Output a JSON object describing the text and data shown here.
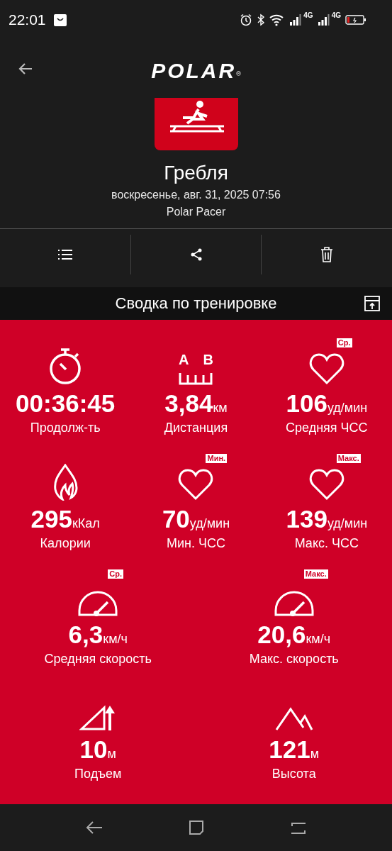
{
  "status_bar": {
    "time": "22:01",
    "network_labels": [
      "4G",
      "4G"
    ]
  },
  "header": {
    "logo": "POLAR",
    "logo_mark": "®"
  },
  "workout": {
    "title": "Гребля",
    "date": "воскресенье, авг. 31, 2025 07:56",
    "device": "Polar Pacer"
  },
  "section": {
    "title": "Сводка по тренировке"
  },
  "stat_rows": [
    [
      {
        "kind": "duration",
        "value": "00:36:45",
        "label": "Продолж-ть"
      },
      {
        "kind": "distance",
        "icon_labels": [
          "A",
          "B"
        ],
        "value": "3,84",
        "unit": "км",
        "label": "Дистанция"
      },
      {
        "kind": "heart",
        "badge": "Ср.",
        "value": "106",
        "unit": "уд/мин",
        "label": "Средняя ЧСС"
      }
    ],
    [
      {
        "kind": "calories",
        "value": "295",
        "unit": "кКал",
        "label": "Калории"
      },
      {
        "kind": "heart",
        "badge": "Мин.",
        "value": "70",
        "unit": "уд/мин",
        "label": "Мин. ЧСС"
      },
      {
        "kind": "heart",
        "badge": "Макс.",
        "value": "139",
        "unit": "уд/мин",
        "label": "Макс. ЧСС"
      }
    ],
    [
      {
        "kind": "speed",
        "badge": "Ср.",
        "value": "6,3",
        "unit": "км/ч",
        "label": "Средняя скорость"
      },
      {
        "kind": "speed",
        "badge": "Макс.",
        "value": "20,6",
        "unit": "км/ч",
        "label": "Макс. скорость"
      }
    ],
    [
      {
        "kind": "ascent",
        "value": "10",
        "unit": "м",
        "label": "Подъем"
      },
      {
        "kind": "altitude",
        "value": "121",
        "unit": "м",
        "label": "Высота"
      }
    ]
  ]
}
